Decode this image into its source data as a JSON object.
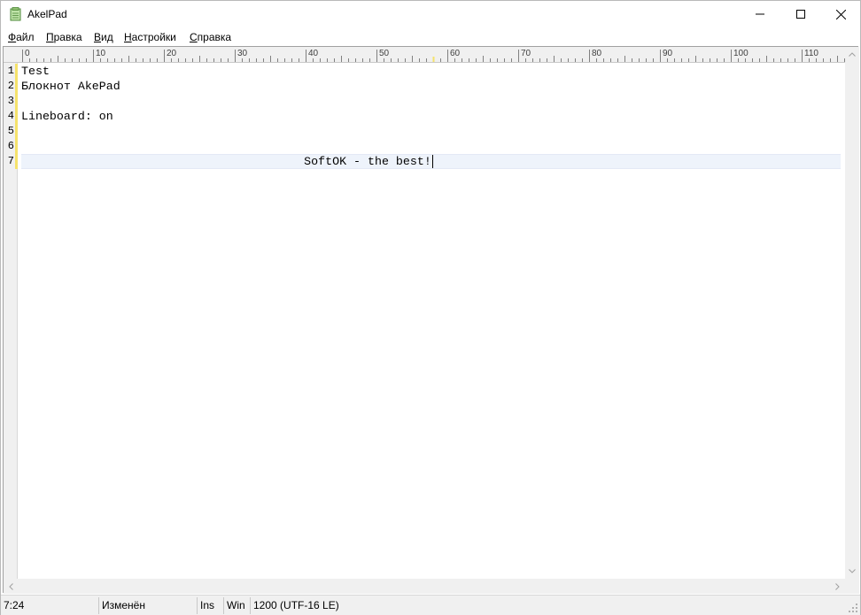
{
  "window": {
    "title": "AkelPad",
    "app_icon": "notepad-icon",
    "controls": [
      "minimize-icon",
      "maximize-icon",
      "close-icon"
    ]
  },
  "menu": {
    "items": [
      {
        "first": "Ф",
        "rest": "айл"
      },
      {
        "first": "П",
        "rest": "равка"
      },
      {
        "first": "В",
        "rest": "ид"
      },
      {
        "first": "Н",
        "rest": "астройки"
      },
      {
        "first": "С",
        "rest": "правка"
      }
    ]
  },
  "ruler": {
    "labels": [
      "0",
      "10",
      "20",
      "30",
      "40",
      "50",
      "60",
      "70",
      "80",
      "90",
      "100",
      "110"
    ]
  },
  "editor": {
    "line_numbers": [
      "1",
      "2",
      "3",
      "4",
      "5",
      "6",
      "7"
    ],
    "lines": [
      "Test",
      "Блокнот AkePad",
      "",
      "Lineboard: on",
      "",
      "",
      "                                        SoftOK - the best!"
    ],
    "current_line": 7
  },
  "statusbar": {
    "position": "7:24",
    "modified": "Изменён",
    "insert_mode": "Ins",
    "newline": "Win",
    "encoding": "1200  (UTF-16 LE)"
  },
  "colors": {
    "gutter_mark": "#f5e26b",
    "current_line": "#eef3fb",
    "chrome": "#f0f0f0"
  }
}
